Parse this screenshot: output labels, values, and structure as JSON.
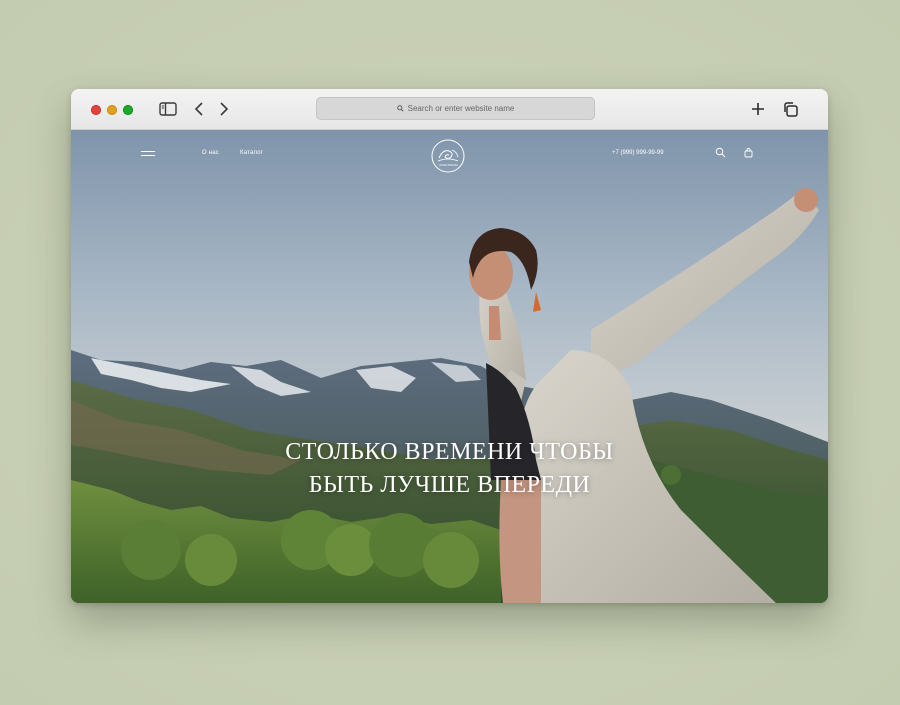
{
  "browser": {
    "address_placeholder": "Search or enter website name",
    "icons": {
      "sidebar": "sidebar-icon",
      "back": "chevron-left-icon",
      "forward": "chevron-right-icon",
      "new_tab": "plus-icon",
      "tabs": "tabs-overview-icon",
      "search": "search-icon"
    }
  },
  "site": {
    "nav": {
      "link_about": "О нас",
      "link_catalog": "Каталог",
      "phone": "+7 (999) 999-99-99",
      "logo_text": "VANA PRANA"
    },
    "hero": {
      "headline_line1": "СТОЛЬКО ВРЕМЕНИ ЧТОБЫ",
      "headline_line2": "БЫТЬ ЛУЧШЕ ВПЕРЕДИ"
    }
  },
  "colors": {
    "background": "#c9d0b6",
    "traffic_red": "#e0443e",
    "traffic_yellow": "#dea123",
    "traffic_green": "#1aab29",
    "hero_text": "#ffffff"
  }
}
